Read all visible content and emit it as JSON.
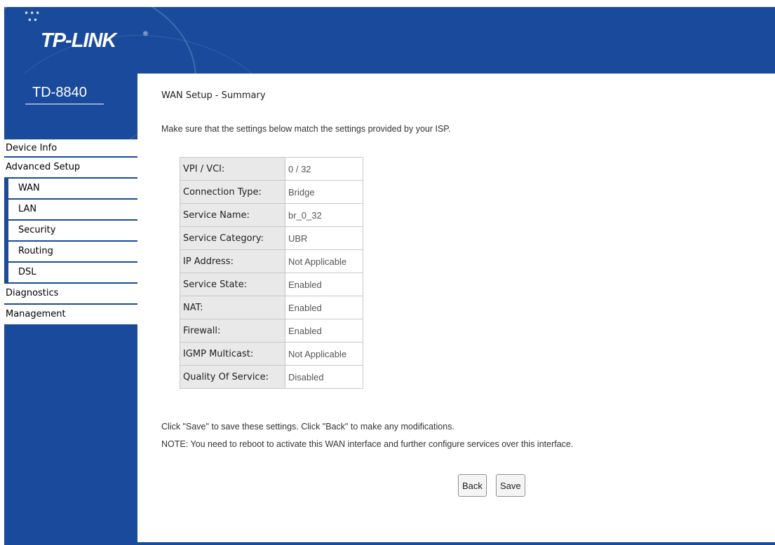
{
  "brand": {
    "logo_text": "TP-LINK",
    "registered_mark": "®",
    "model": "TD-8840",
    "primary_color": "#1a4a9c"
  },
  "sidebar": {
    "items": [
      {
        "label": "Device Info",
        "level": 0
      },
      {
        "label": "Advanced Setup",
        "level": 0
      },
      {
        "label": "WAN",
        "level": 1
      },
      {
        "label": "LAN",
        "level": 1
      },
      {
        "label": "Security",
        "level": 1
      },
      {
        "label": "Routing",
        "level": 1
      },
      {
        "label": "DSL",
        "level": 1
      },
      {
        "label": "Diagnostics",
        "level": 0
      },
      {
        "label": "Management",
        "level": 0
      }
    ]
  },
  "main": {
    "title": "WAN Setup - Summary",
    "intro": "Make sure that the settings below match the settings provided by your ISP.",
    "summary": [
      {
        "key": "VPI / VCI:",
        "value": "0 / 32"
      },
      {
        "key": "Connection Type:",
        "value": "Bridge"
      },
      {
        "key": "Service Name:",
        "value": "br_0_32"
      },
      {
        "key": "Service Category:",
        "value": "UBR"
      },
      {
        "key": "IP Address:",
        "value": "Not Applicable"
      },
      {
        "key": "Service State:",
        "value": "Enabled"
      },
      {
        "key": "NAT:",
        "value": "Enabled"
      },
      {
        "key": "Firewall:",
        "value": "Enabled"
      },
      {
        "key": "IGMP Multicast:",
        "value": "Not Applicable"
      },
      {
        "key": "Quality Of Service:",
        "value": "Disabled"
      }
    ],
    "instruction": "Click \"Save\" to save these settings. Click \"Back\" to make any modifications.",
    "note": "NOTE: You need to reboot to activate this WAN interface and further configure services over this interface.",
    "back_label": "Back",
    "save_label": "Save"
  }
}
